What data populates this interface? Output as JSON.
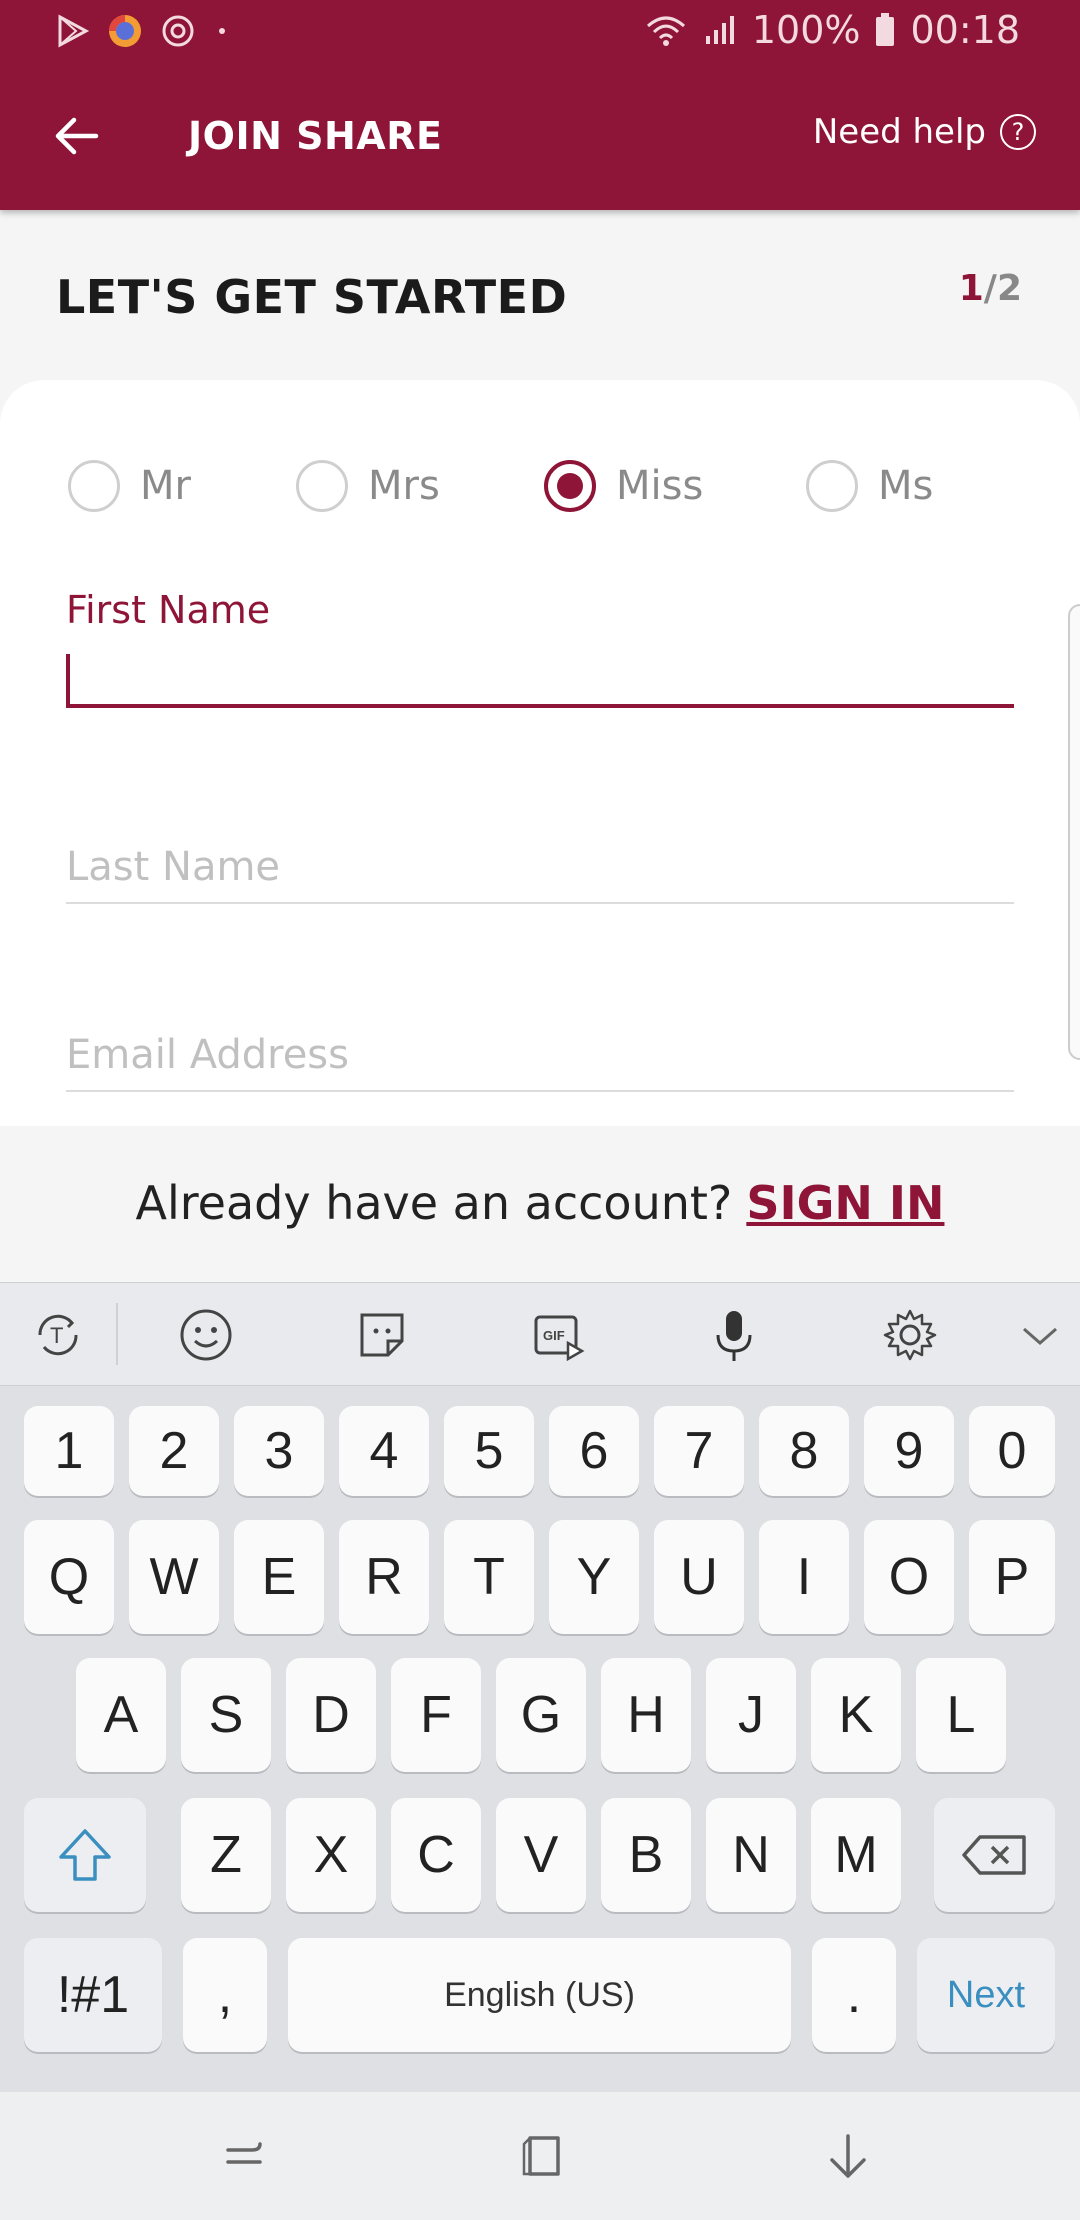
{
  "status": {
    "battery": "100%",
    "time": "00:18"
  },
  "appbar": {
    "title": "JOIN SHARE",
    "help_label": "Need help",
    "help_icon_text": "?"
  },
  "page": {
    "heading": "LET'S GET STARTED",
    "step_current": "1",
    "step_total": "/2"
  },
  "titles": [
    {
      "label": "Mr",
      "selected": false
    },
    {
      "label": "Mrs",
      "selected": false
    },
    {
      "label": "Miss",
      "selected": true
    },
    {
      "label": "Ms",
      "selected": false
    }
  ],
  "form": {
    "first_name_label": "First Name",
    "last_name_placeholder": "Last Name",
    "email_placeholder": "Email Address"
  },
  "signin": {
    "prompt": "Already have an account?",
    "link": "SIGN IN"
  },
  "keyboard": {
    "row_numbers": [
      "1",
      "2",
      "3",
      "4",
      "5",
      "6",
      "7",
      "8",
      "9",
      "0"
    ],
    "row_top": [
      "Q",
      "W",
      "E",
      "R",
      "T",
      "Y",
      "U",
      "I",
      "O",
      "P"
    ],
    "row_mid": [
      "A",
      "S",
      "D",
      "F",
      "G",
      "H",
      "J",
      "K",
      "L"
    ],
    "row_bottom": [
      "Z",
      "X",
      "C",
      "V",
      "B",
      "N",
      "M"
    ],
    "symbols": "!#1",
    "comma": ",",
    "space": "English (US)",
    "period": ".",
    "next": "Next"
  },
  "colors": {
    "brand": "#8e1537",
    "keyboard_bg": "#dfe0e4",
    "next_accent": "#3b8fc0"
  }
}
